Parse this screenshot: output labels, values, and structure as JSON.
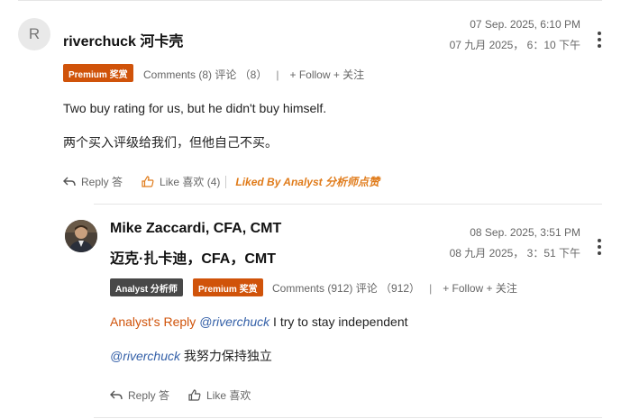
{
  "comment1": {
    "avatar_letter": "R",
    "name": "riverchuck 河卡壳",
    "date_en": "07 Sep. 2025, 6:10 PM",
    "date_cn": "07 九月 2025， 6：10 下午",
    "badge_premium": "Premium 奖赏",
    "comments_label": "Comments (8) 评论 （8）",
    "separator": "|",
    "follow_label": "+ Follow + 关注",
    "text_en": "Two buy rating for us, but he didn't buy himself.",
    "text_cn": "两个买入评级给我们，但他自己不买。",
    "reply_label": "Reply 答",
    "like_label": "Like 喜欢 (4)",
    "liked_by": "Liked By Analyst 分析师点赞"
  },
  "comment2": {
    "name_en": "Mike Zaccardi, CFA, CMT",
    "name_cn": "迈克·扎卡迪，CFA，CMT",
    "date_en": "08 Sep. 2025, 3:51 PM",
    "date_cn": "08 九月 2025， 3：51 下午",
    "badge_analyst": "Analyst 分析师",
    "badge_premium": "Premium 奖赏",
    "comments_label": "Comments (912) 评论 （912）",
    "separator": "|",
    "follow_label": "+ Follow + 关注",
    "reply_prefix": "Analyst's Reply",
    "mention": "@riverchuck",
    "text_en": " I try to stay independent",
    "text_cn": " 我努力保持独立",
    "reply_label": "Reply 答",
    "like_label": "Like 喜欢"
  },
  "colors": {
    "premium": "#d0530a",
    "analyst_badge": "#484848",
    "liked_by": "#e07b1a",
    "mention": "#3460a8"
  },
  "icons": [
    "kebab-menu-icon",
    "reply-arrow-icon",
    "thumbs-up-icon"
  ]
}
